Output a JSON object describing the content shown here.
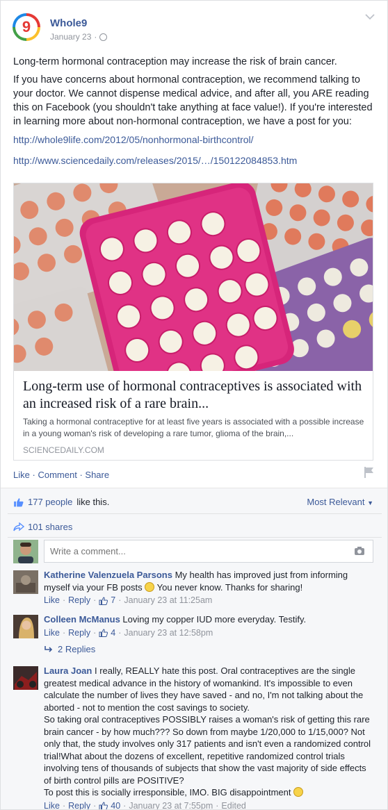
{
  "post": {
    "page_name": "Whole9",
    "date": "January 23",
    "paragraphs": [
      "Long-term hormonal contraception may increase the risk of brain cancer.",
      "If you have concerns about hormonal contraception, we recommend talking to your doctor. We cannot dispense medical advice, and after all, you ARE reading this on Facebook (you shouldn't take anything at face value!). If you're interested in learning more about non-hormonal contraception, we have a post for you:"
    ],
    "urls": [
      "http://whole9life.com/2012/05/nonhormonal-birthcontrol/",
      "http://www.sciencedaily.com/releases/2015/…/150122084853.htm"
    ],
    "logo_digit": "9"
  },
  "preview": {
    "title": "Long-term use of hormonal contraceptives is associated with an increased risk of a rare brain...",
    "description": "Taking a hormonal contraceptive for at least five years is associated with a possible increase in a young woman's risk of developing a rare tumor, glioma of the brain,...",
    "source": "SCIENCEDAILY.COM"
  },
  "actions": {
    "like": "Like",
    "comment": "Comment",
    "share": "Share",
    "separator": "·"
  },
  "feedback": {
    "likes_count": "177 people",
    "likes_suffix": "like this.",
    "sort": "Most Relevant",
    "shares": "101 shares",
    "comment_placeholder": "Write a comment..."
  },
  "comments": [
    {
      "author": "Katherine Valenzuela Parsons",
      "text_before": "My health has improved just from informing myself via your FB posts",
      "text_after": "You never know. Thanks for sharing!",
      "like": "Like",
      "reply": "Reply",
      "likes": "7",
      "timestamp": "January 23 at 11:25am"
    },
    {
      "author": "Colleen McManus",
      "text": "Loving my copper IUD more everyday. Testify.",
      "like": "Like",
      "reply": "Reply",
      "likes": "4",
      "timestamp": "January 23 at 12:58pm",
      "replies_label": "2 Replies"
    },
    {
      "author": "Laura Joan",
      "text_1": "I really, REALLY hate this post. Oral contraceptives are the single greatest medical advance in the history of womankind. It's impossible to even calculate the number of lives they have saved - and no, I'm not talking about the aborted - not to mention the cost savings to society.",
      "text_2": "So taking oral contraceptives POSSIBLY raises a woman's risk of getting this rare brain cancer - by how much??? So down from maybe 1/20,000 to 1/15,000? Not only that, the study involves only 317 patients and isn't even a randomized control trial!What about the dozens of excellent, repetitive randomized control trials involving tens of thousands of subjects that show the vast majority of side effects of birth control pills are POSITIVE?",
      "text_3": "To post this is socially irresponsible, IMO. BIG disappointment",
      "like": "Like",
      "reply": "Reply",
      "likes": "40",
      "timestamp": "January 23 at 7:55pm",
      "edited": "Edited"
    }
  ]
}
